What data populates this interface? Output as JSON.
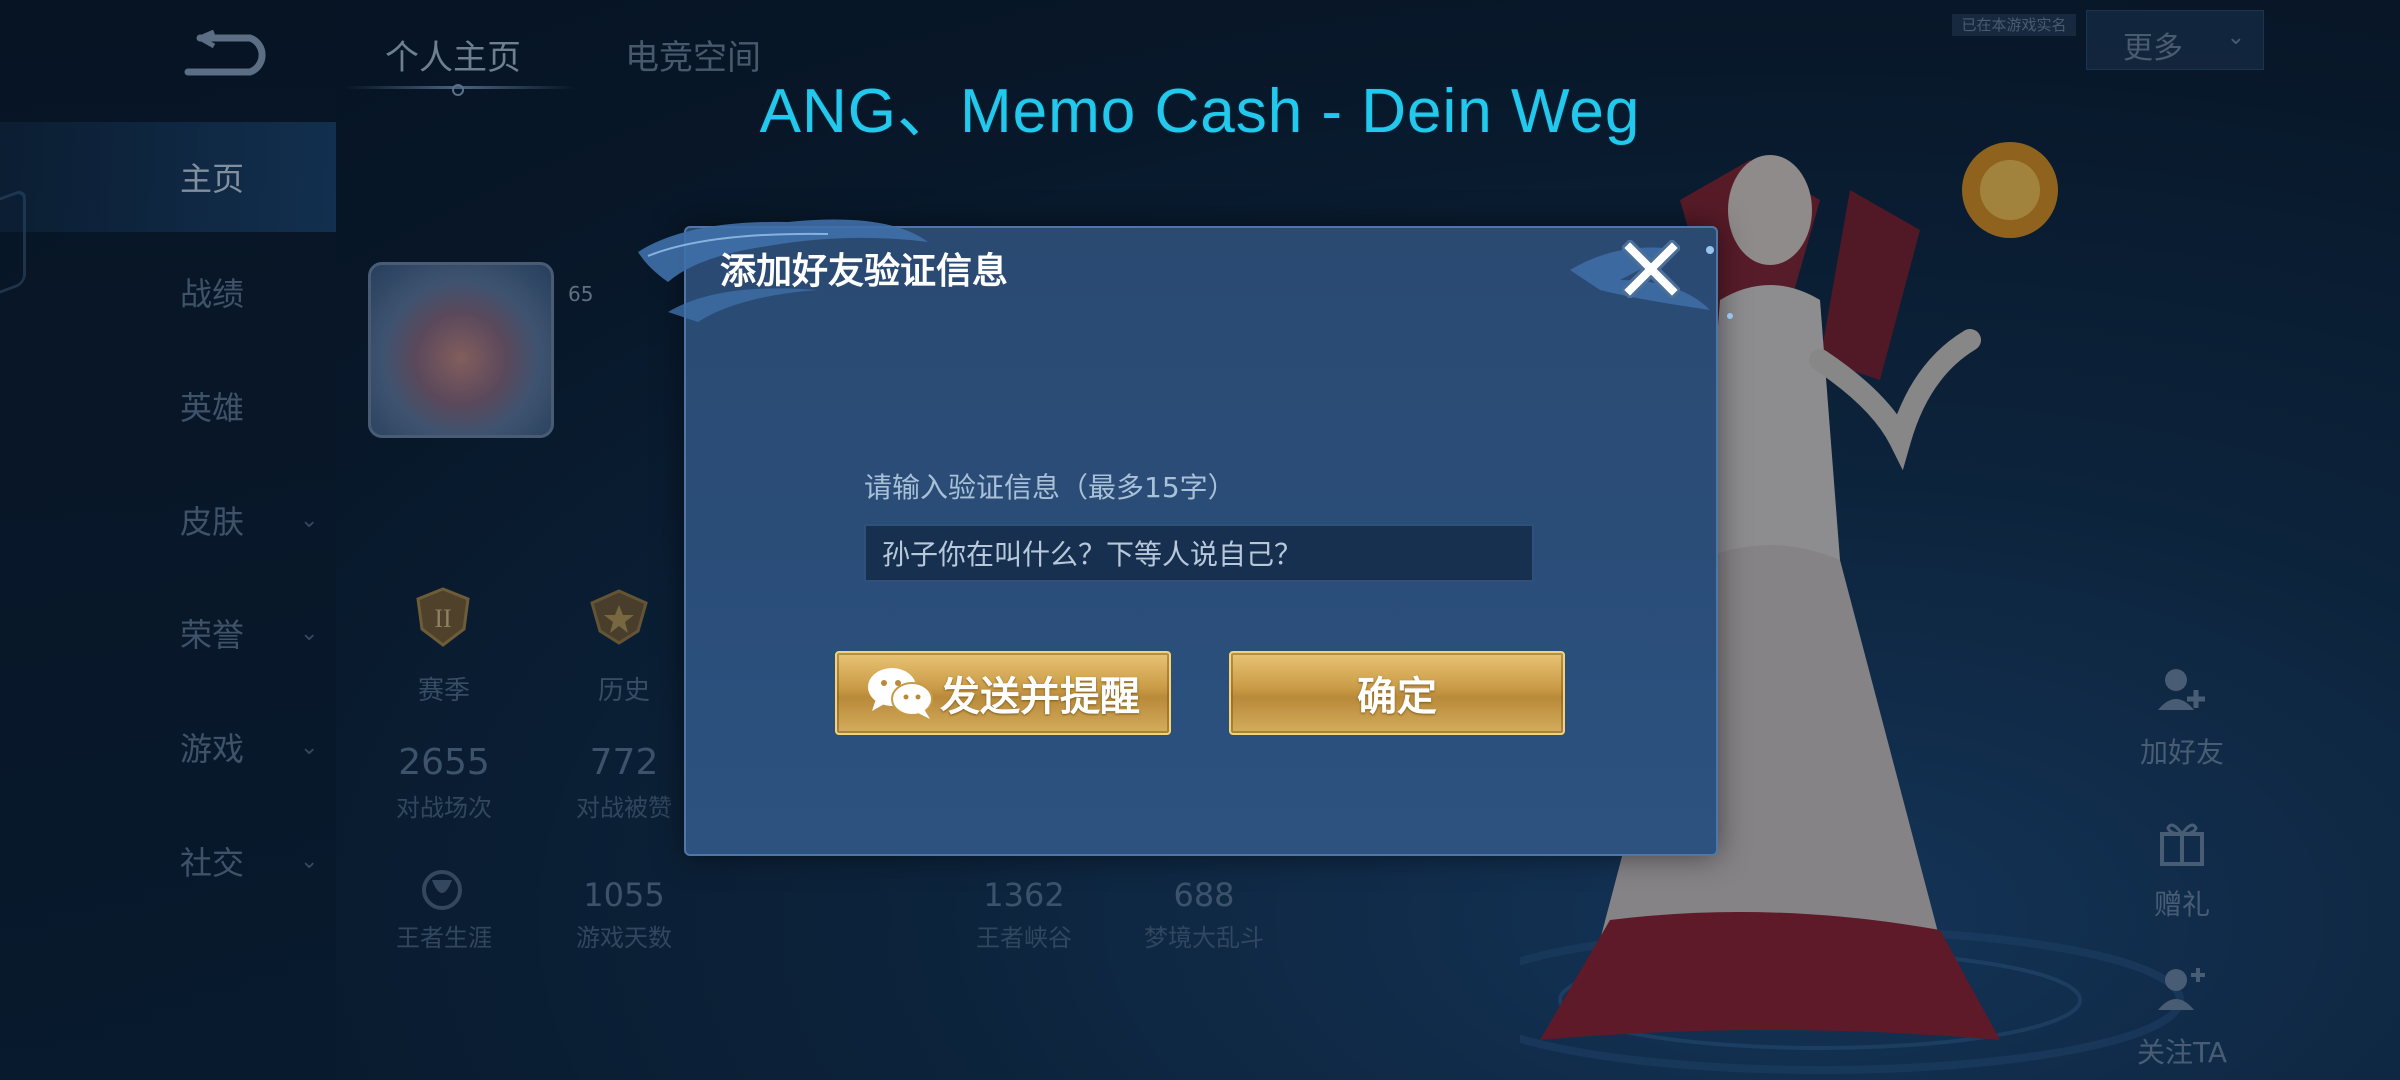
{
  "header": {
    "song": "ANG、Memo Cash - Dein Weg",
    "tabs": [
      "个人主页",
      "电竞空间"
    ],
    "note": "已在本游戏实名",
    "more_label": "更多"
  },
  "sidebar": {
    "items": [
      {
        "label": "主页",
        "active": true
      },
      {
        "label": "战绩"
      },
      {
        "label": "英雄"
      },
      {
        "label": "皮肤",
        "chevron": true
      },
      {
        "label": "荣誉",
        "chevron": true
      },
      {
        "label": "游戏",
        "chevron": true
      },
      {
        "label": "社交",
        "chevron": true
      }
    ]
  },
  "profile": {
    "level": "65",
    "badges": [
      {
        "label": "赛季",
        "icon": "season-rank-icon"
      },
      {
        "label": "历史",
        "icon": "history-rank-icon"
      }
    ],
    "stats_row1": [
      {
        "value": "2655",
        "label": "对战场次"
      },
      {
        "value": "772",
        "label": "对战被赞"
      }
    ],
    "stats_row2": [
      {
        "value": "",
        "label": "王者生涯"
      },
      {
        "value": "1055",
        "label": "游戏天数"
      },
      {
        "value": "1362",
        "label": "王者峡谷"
      },
      {
        "value": "688",
        "label": "梦境大乱斗"
      }
    ]
  },
  "side_actions": [
    "加好友",
    "赠礼",
    "关注TA"
  ],
  "dialog": {
    "title": "添加好友验证信息",
    "prompt": "请输入验证信息（最多15字）",
    "input_value": "孙子你在叫什么？下等人说自己？",
    "send_label": "发送并提醒",
    "confirm_label": "确定"
  },
  "colors": {
    "song_title": "#23c9ec",
    "gold_button": "#c99a45",
    "dialog_bg": "#2a4a72"
  }
}
